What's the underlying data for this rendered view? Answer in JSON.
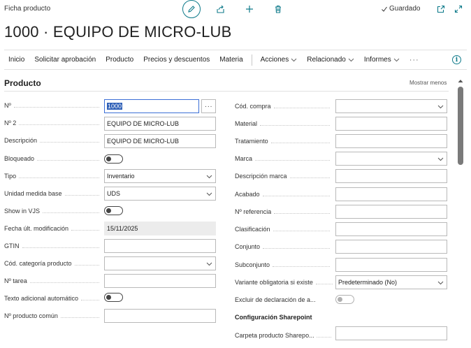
{
  "header": {
    "breadcrumb": "Ficha producto",
    "saved_label": "Guardado",
    "icons": [
      "edit-icon",
      "share-icon",
      "plus-icon",
      "trash-icon",
      "check-icon",
      "popout-icon",
      "expand-icon"
    ]
  },
  "page_title": "1000 · EQUIPO DE MICRO-LUB",
  "action_bar": {
    "items": [
      "Inicio",
      "Solicitar aprobación",
      "Producto",
      "Precios y descuentos",
      "Materia"
    ],
    "dropdowns": [
      "Acciones",
      "Relacionado",
      "Informes"
    ],
    "more": "···",
    "info_icon": "info-icon"
  },
  "section": {
    "title": "Producto",
    "show_less": "Mostrar menos"
  },
  "left_fields": [
    {
      "label": "Nº",
      "value": "1000",
      "kind": "text-assist"
    },
    {
      "label": "Nº 2",
      "value": "EQUIPO DE MICRO-LUB",
      "kind": "text"
    },
    {
      "label": "Descripción",
      "value": "EQUIPO DE MICRO-LUB",
      "kind": "text"
    },
    {
      "label": "Bloqueado",
      "value": "off",
      "kind": "toggle"
    },
    {
      "label": "Tipo",
      "value": "Inventario",
      "kind": "select"
    },
    {
      "label": "Unidad medida base",
      "value": "UDS",
      "kind": "select"
    },
    {
      "label": "Show in VJS",
      "value": "off",
      "kind": "toggle"
    },
    {
      "label": "Fecha últ. modificación",
      "value": "15/11/2025",
      "kind": "readonly"
    },
    {
      "label": "GTIN",
      "value": "",
      "kind": "text"
    },
    {
      "label": "Cód. categoría producto",
      "value": "",
      "kind": "select"
    },
    {
      "label": "Nº tarea",
      "value": "",
      "kind": "text"
    },
    {
      "label": "Texto adicional automático",
      "value": "off",
      "kind": "toggle"
    },
    {
      "label": "Nº producto común",
      "value": "",
      "kind": "text"
    }
  ],
  "right_fields": [
    {
      "label": "Cód. compra",
      "value": "",
      "kind": "select"
    },
    {
      "label": "Material",
      "value": "",
      "kind": "text"
    },
    {
      "label": "Tratamiento",
      "value": "",
      "kind": "text"
    },
    {
      "label": "Marca",
      "value": "",
      "kind": "select"
    },
    {
      "label": "Descripción marca",
      "value": "",
      "kind": "text"
    },
    {
      "label": "Acabado",
      "value": "",
      "kind": "text"
    },
    {
      "label": "Nº referencia",
      "value": "",
      "kind": "text"
    },
    {
      "label": "Clasificación",
      "value": "",
      "kind": "text"
    },
    {
      "label": "Conjunto",
      "value": "",
      "kind": "text"
    },
    {
      "label": "Subconjunto",
      "value": "",
      "kind": "text"
    },
    {
      "label": "Variante obligatoria si existe",
      "value": "Predeterminado (No)",
      "kind": "select"
    },
    {
      "label": "Excluir de declaración de a...",
      "value": "off",
      "kind": "toggle-disabled"
    }
  ],
  "sharepoint": {
    "title": "Configuración Sharepoint",
    "label": "Carpeta producto Sharepo...",
    "value": ""
  }
}
